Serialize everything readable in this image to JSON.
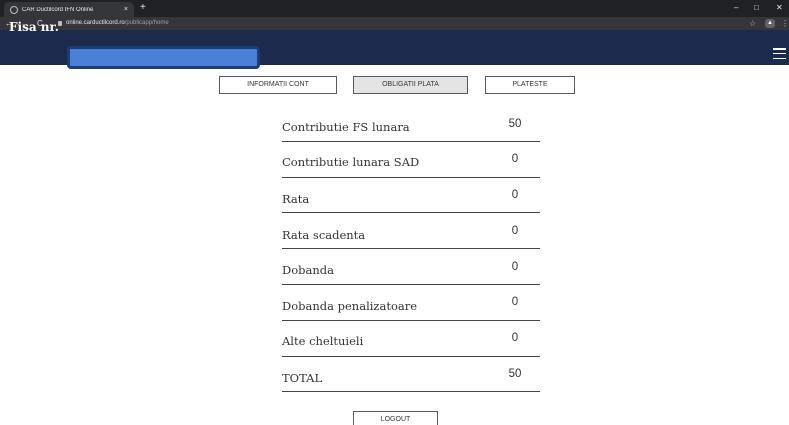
{
  "browser": {
    "tab_title": "CAR Ductilcord IFN Online",
    "tab_close": "×",
    "new_tab": "+",
    "url_host": "online.carductilcord.ro",
    "url_path": "/publicapp/home",
    "back": "←",
    "forward": "→",
    "reload": "C",
    "star": "☆",
    "profile": "▲",
    "kebab": "⋮",
    "minimize": "–",
    "maximize": "□",
    "close": "✕"
  },
  "header": {
    "brand": "Fisa nr."
  },
  "tabs": [
    {
      "label": "INFORMATII CONT",
      "active": false
    },
    {
      "label": "OBLIGATII PLATA",
      "active": true
    },
    {
      "label": "PLATESTE",
      "active": false
    }
  ],
  "rows": [
    {
      "label": "Contributie FS lunara",
      "value": "50"
    },
    {
      "label": "Contributie lunara SAD",
      "value": "0"
    },
    {
      "label": "Rata",
      "value": "0"
    },
    {
      "label": "Rata scadenta",
      "value": "0"
    },
    {
      "label": "Dobanda",
      "value": "0"
    },
    {
      "label": "Dobanda penalizatoare",
      "value": "0"
    },
    {
      "label": "Alte cheltuieli",
      "value": "0"
    },
    {
      "label": "TOTAL",
      "value": "50"
    }
  ],
  "logout_label": "LOGOUT",
  "colors": {
    "header_bg": "#1c2a4d",
    "redaction": "#4a80d6"
  }
}
